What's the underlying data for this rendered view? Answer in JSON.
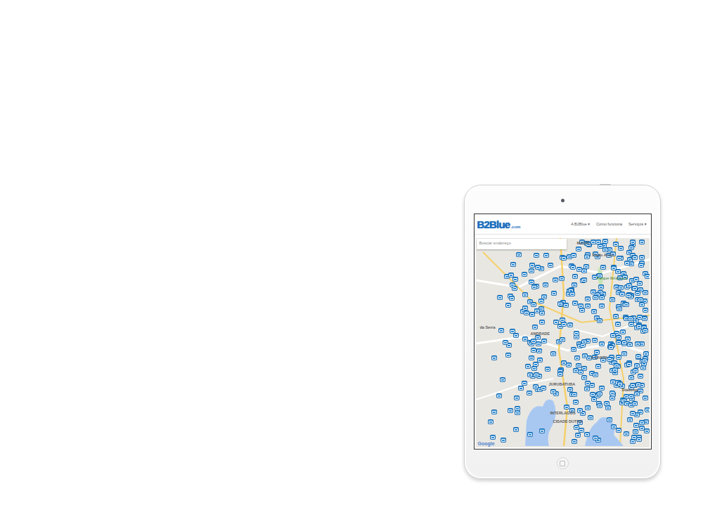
{
  "logo": {
    "text": "B2Blue",
    "suffix": ".com"
  },
  "nav": [
    {
      "label": "A B2Blue",
      "caret": "▾"
    },
    {
      "label": "Como funciona"
    },
    {
      "label": "Serviços",
      "caret": "▾"
    }
  ],
  "search": {
    "placeholder": "Buscar endereço"
  },
  "map": {
    "labels": [
      "MADAL",
      "Paulo Assis",
      "Parque Ibirapuera",
      "da Serra",
      "ANDRADE",
      "A SANTA",
      "Diadema",
      "JURUBATUBA",
      "INTERLAGOS",
      "CIDADE DUTRA"
    ],
    "attribution": "Google"
  }
}
